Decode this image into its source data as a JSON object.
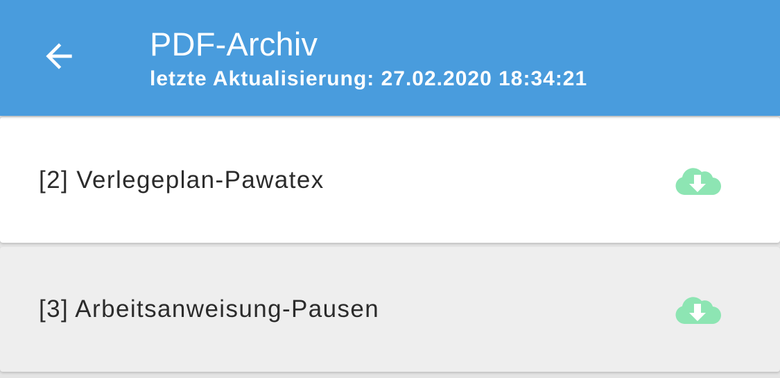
{
  "header": {
    "back_icon": "arrow-left-icon",
    "title": "PDF-Archiv",
    "subtitle": "letzte Aktualisierung: 27.02.2020 18:34:21",
    "background_color": "#499cdd",
    "text_color": "#ffffff"
  },
  "documents": [
    {
      "label": "[2] Verlegeplan-Pawatex",
      "action_icon": "cloud-download-icon"
    },
    {
      "label": "[3] Arbeitsanweisung-Pausen",
      "action_icon": "cloud-download-icon"
    }
  ],
  "colors": {
    "download_icon": "#8de5b3",
    "row_alternate": "#eeeeee",
    "row_default": "#ffffff"
  }
}
